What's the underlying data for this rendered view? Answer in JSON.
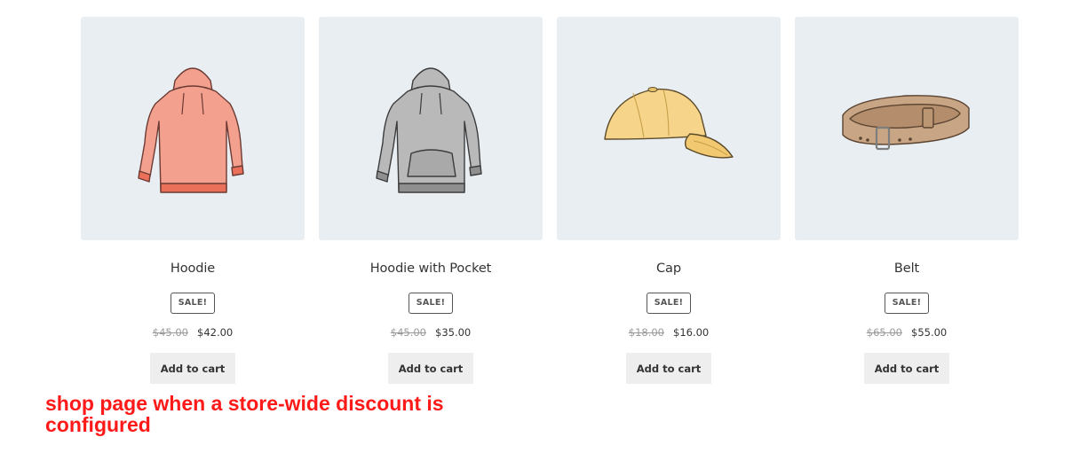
{
  "products": [
    {
      "name": "Hoodie",
      "badge": "SALE!",
      "regular_price": "$45.00",
      "sale_price": "$42.00",
      "button": "Add to cart",
      "image_icon": "pink-hoodie-icon",
      "color": "#f4a08e"
    },
    {
      "name": "Hoodie with Pocket",
      "badge": "SALE!",
      "regular_price": "$45.00",
      "sale_price": "$35.00",
      "button": "Add to cart",
      "image_icon": "gray-hoodie-pocket-icon",
      "color": "#b9b9b9"
    },
    {
      "name": "Cap",
      "badge": "SALE!",
      "regular_price": "$18.00",
      "sale_price": "$16.00",
      "button": "Add to cart",
      "image_icon": "yellow-cap-icon",
      "color": "#f6d58a"
    },
    {
      "name": "Belt",
      "badge": "SALE!",
      "regular_price": "$65.00",
      "sale_price": "$55.00",
      "button": "Add to cart",
      "image_icon": "brown-belt-icon",
      "color": "#c8a584"
    }
  ],
  "annotation": {
    "text": "shop page when a store-wide discount is configured",
    "color": "#ff1a1a"
  }
}
